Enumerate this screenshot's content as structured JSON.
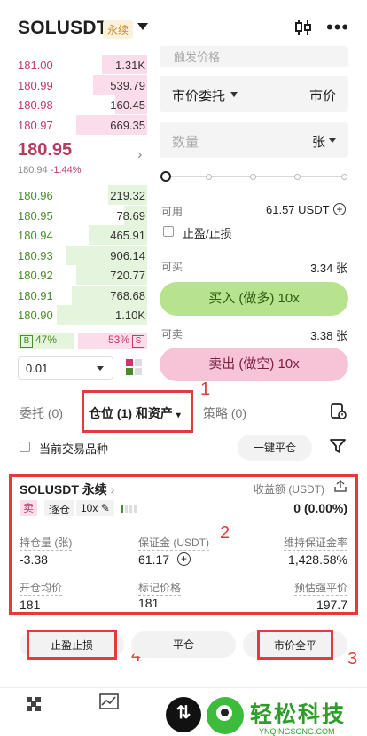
{
  "header": {
    "symbol": "SOLUSDT",
    "tag": "永续"
  },
  "orderbook": {
    "asks": [
      {
        "price": "181.00",
        "qty": "1.31K",
        "depth": 0.35
      },
      {
        "price": "180.99",
        "qty": "539.79",
        "depth": 0.42
      },
      {
        "price": "180.98",
        "qty": "160.45",
        "depth": 0.25
      },
      {
        "price": "180.97",
        "qty": "669.35",
        "depth": 0.55
      }
    ],
    "last_price": "180.95",
    "mark_price": "180.94",
    "change": "-1.44%",
    "bids": [
      {
        "price": "180.96",
        "qty": "219.32",
        "depth": 0.3
      },
      {
        "price": "180.95",
        "qty": "78.69",
        "depth": 0.18
      },
      {
        "price": "180.94",
        "qty": "465.91",
        "depth": 0.45
      },
      {
        "price": "180.93",
        "qty": "906.14",
        "depth": 0.62
      },
      {
        "price": "180.92",
        "qty": "720.77",
        "depth": 0.55
      },
      {
        "price": "180.91",
        "qty": "768.68",
        "depth": 0.58
      },
      {
        "price": "180.90",
        "qty": "1.10K",
        "depth": 0.7
      }
    ],
    "buy_ratio_label": "B",
    "buy_ratio": "47%",
    "sell_ratio": "53%",
    "sell_ratio_label": "S",
    "precision": "0.01"
  },
  "order_panel": {
    "price_placeholder": "触发价格",
    "order_type": "市价委托",
    "price_mode": "市价",
    "qty_placeholder": "数量",
    "qty_unit": "张",
    "available_label": "可用",
    "available_value": "61.57 USDT",
    "tpsl_label": "止盈/止损",
    "can_buy_label": "可买",
    "can_buy_value": "3.34 张",
    "buy_button": "买入 (做多) 10x",
    "can_sell_label": "可卖",
    "can_sell_value": "3.38 张",
    "sell_button": "卖出 (做空) 10x"
  },
  "tabs": {
    "orders": "委托 (0)",
    "positions": "仓位 (1) 和资产",
    "strategy": "策略 (0)"
  },
  "filter": {
    "current_symbol": "当前交易品种",
    "close_all": "一键平仓"
  },
  "position": {
    "symbol": "SOLUSDT 永续",
    "pnl_label": "收益额 (USDT)",
    "side": "卖",
    "margin_mode": "逐仓",
    "leverage": "10x",
    "pnl_value": "0 (0.00%)",
    "size_label": "持仓量 (张)",
    "size_value": "-3.38",
    "margin_label": "保证金 (USDT)",
    "margin_value": "61.17",
    "mmr_label": "维持保证金率",
    "mmr_value": "1,428.58%",
    "entry_label": "开仓均价",
    "entry_value": "181",
    "mark_label": "标记价格",
    "mark_value": "181",
    "liq_label": "预估强平价",
    "liq_value": "197.7"
  },
  "actions": {
    "tpsl": "止盈止损",
    "close": "平仓",
    "market_close": "市价全平"
  },
  "annotations": {
    "n1": "1",
    "n2": "2",
    "n3": "3",
    "n4": "4"
  },
  "watermark": {
    "name": "轻松科技",
    "url": "YNQINGSONG.COM"
  },
  "colors": {
    "ask": "#c33a67",
    "bid": "#4a8c2a",
    "annotation": "#e23b3b"
  }
}
